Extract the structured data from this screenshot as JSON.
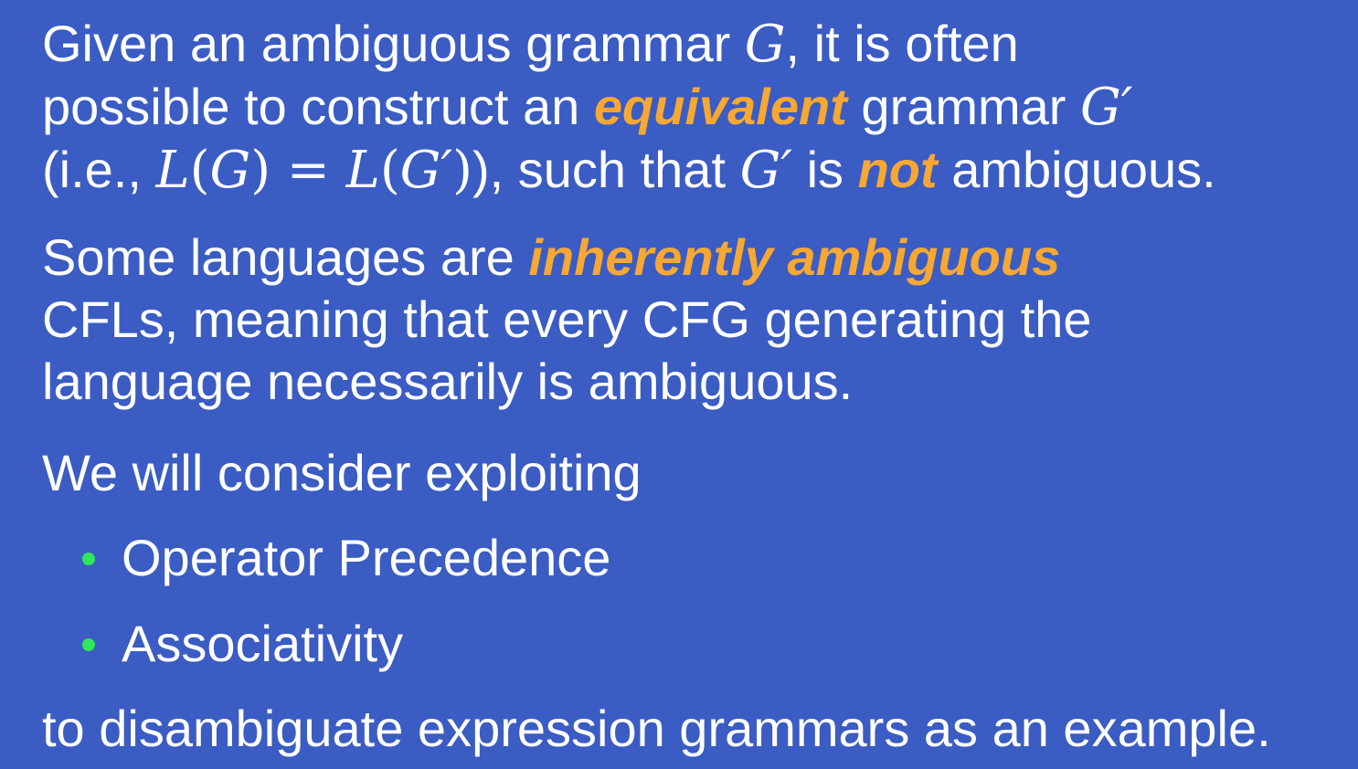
{
  "slide": {
    "para1": {
      "line1_text": "Given an ambiguous grammar ",
      "line1_math": "G",
      "line1_rest": ", it is often",
      "line2_text": "possible to construct an ",
      "line2_emph": "equivalent",
      "line2_rest": " grammar ",
      "line2_math": "G′",
      "line3_open": "(i.e., ",
      "line3_math1": "L",
      "line3_math2": "(",
      "line3_math3": "G",
      "line3_math4": ") = ",
      "line3_math5": "L",
      "line3_math6": "(",
      "line3_math7": "G′",
      "line3_math8": ")",
      "line3_mid": "), such that ",
      "line3_math9": "G′",
      "line3_is": " is ",
      "line3_emph": "not",
      "line3_rest": " ambiguous."
    },
    "para2": {
      "line1_text": "Some languages are ",
      "line1_emph": "inherently ambiguous",
      "line2_text": "CFLs, meaning that every CFG generating the",
      "line3_text": "language necessarily is ambiguous."
    },
    "para3": {
      "text": "We will consider exploiting"
    },
    "bullets": [
      {
        "label": "Operator Precedence"
      },
      {
        "label": "Associativity"
      }
    ],
    "para4": {
      "text": "to disambiguate expression grammars as an example."
    },
    "colors": {
      "background": "#3a5cc3",
      "text": "#ffffff",
      "emphasis": "#f7a833",
      "bullet": "#2ee85a"
    }
  }
}
